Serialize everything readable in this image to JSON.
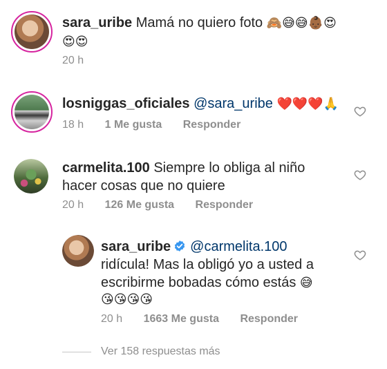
{
  "comments": [
    {
      "username": "sara_uribe",
      "text": "Mamá no quiero foto",
      "emojis_line1": "🙈😅😅👶🏾😍",
      "emojis_line2": "😍😍",
      "time": "20 h"
    },
    {
      "username": "losniggas_oficiales",
      "mention": "@sara_uribe",
      "emojis": "❤️❤️❤️🙏",
      "time": "18 h",
      "likes": "1 Me gusta",
      "reply": "Responder"
    },
    {
      "username": "carmelita.100",
      "text_line1": "Siempre lo obliga al niño",
      "text_line2": "hacer cosas que no quiere",
      "time": "20 h",
      "likes": "126 Me gusta",
      "reply": "Responder"
    },
    {
      "username": "sara_uribe",
      "mention": "@carmelita.100",
      "text_line1": "ridícula! Mas la obligó yo a usted a",
      "text_line2": "escribirme bobadas cómo estás",
      "emoji_inline": "😅",
      "emojis_line3": "😘😘😘😘",
      "time": "20 h",
      "likes": "1663 Me gusta",
      "reply": "Responder"
    }
  ],
  "view_more": "Ver 158 respuestas más",
  "colors": {
    "text": "#262626",
    "meta": "#8e8e8e",
    "mention": "#00376b",
    "verified": "#3897f0",
    "ring": "#d6249f"
  }
}
